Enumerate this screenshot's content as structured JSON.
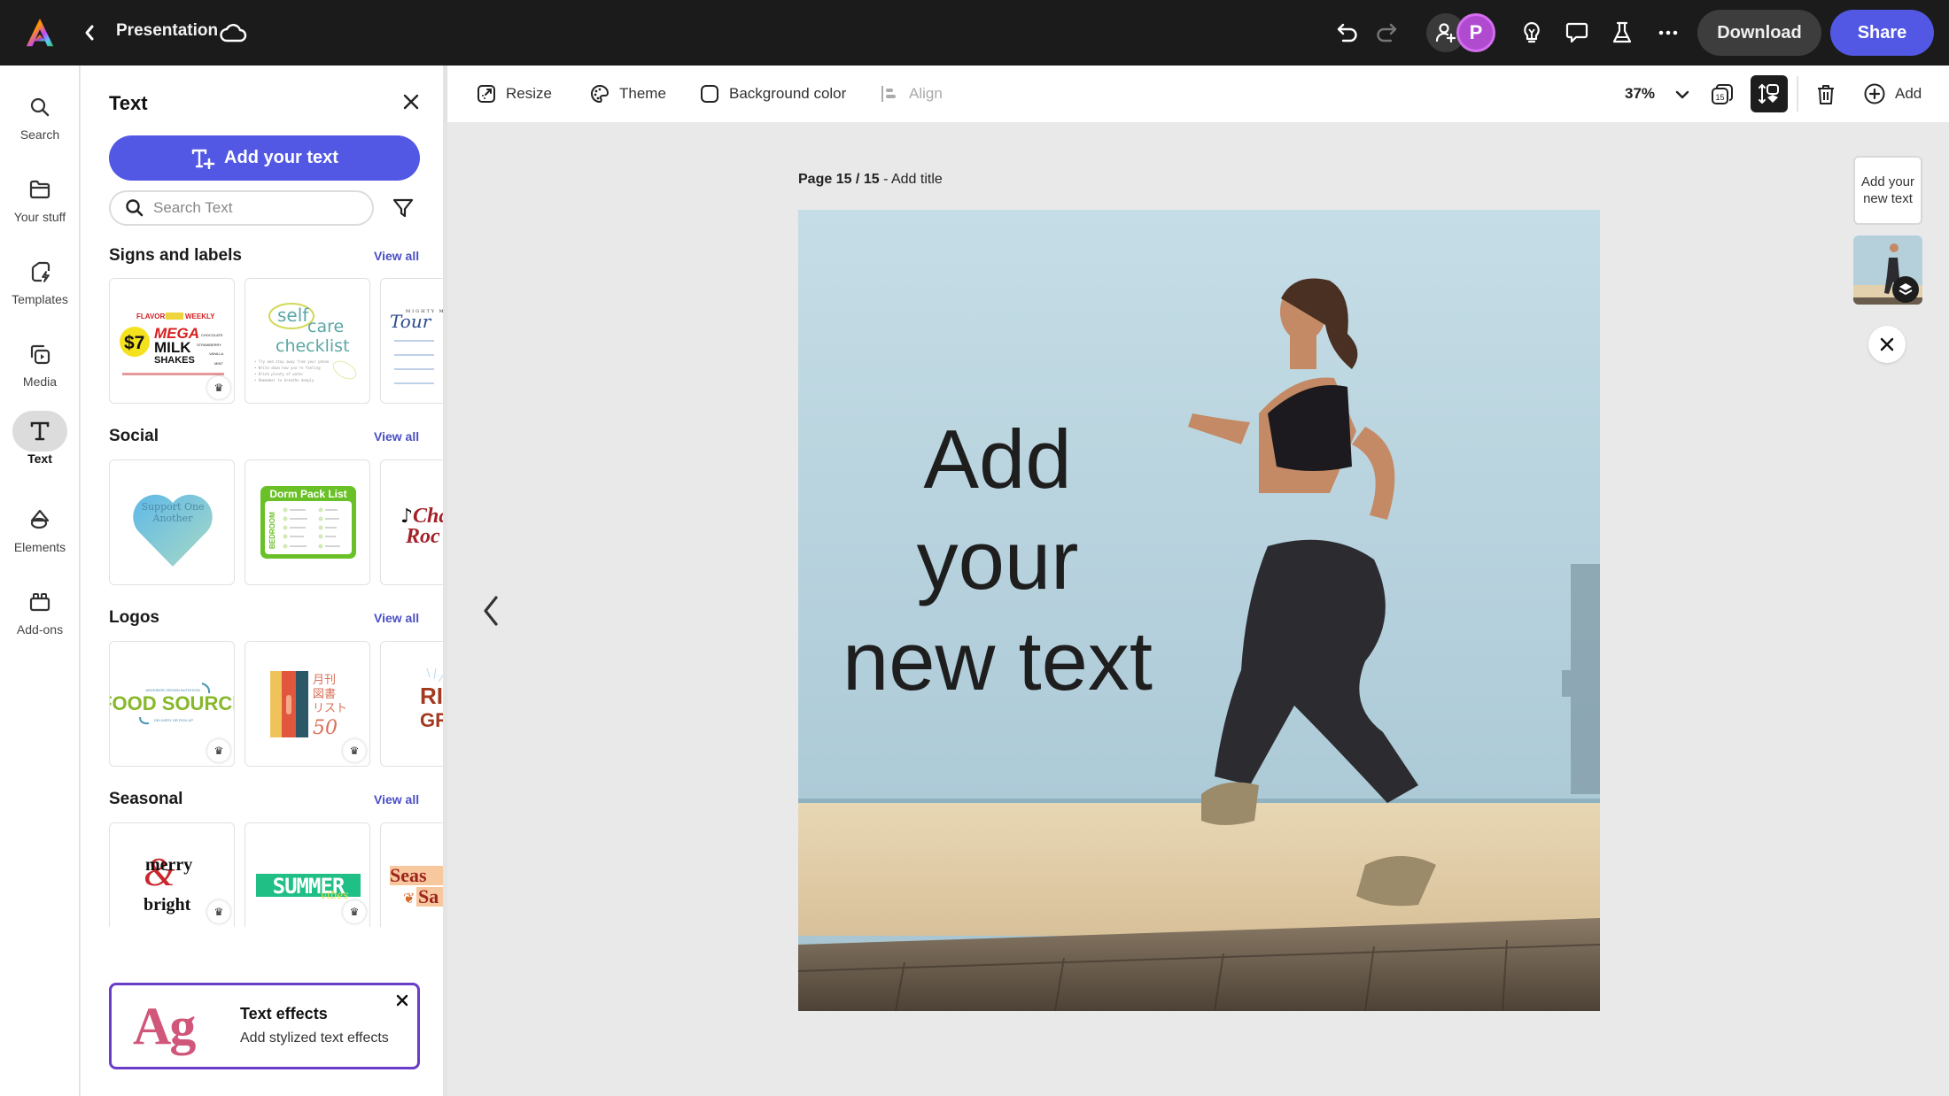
{
  "app": {
    "title": "Presentation",
    "logo_icon": "adobe-express-logo",
    "colors": {
      "accent": "#5258e4",
      "topbar": "#1b1b1b",
      "link": "#4b4fc4",
      "fx_border": "#6a3dc9"
    }
  },
  "topbar": {
    "back_icon": "chevron-left-icon",
    "cloud_icon": "cloud-icon",
    "undo_icon": "undo-icon",
    "redo_icon": "redo-icon",
    "invite_icon": "add-user-icon",
    "avatar_initial": "P",
    "tips_icon": "lightbulb-icon",
    "comments_icon": "comment-icon",
    "labs_icon": "flask-icon",
    "more_icon": "more-icon",
    "download_label": "Download",
    "share_label": "Share"
  },
  "rail": {
    "items": [
      {
        "label": "Search",
        "icon": "search-icon",
        "active": false
      },
      {
        "label": "Your stuff",
        "icon": "folder-icon",
        "active": false
      },
      {
        "label": "Templates",
        "icon": "templates-icon",
        "active": false
      },
      {
        "label": "Media",
        "icon": "media-icon",
        "active": false
      },
      {
        "label": "Text",
        "icon": "text-icon",
        "active": true
      },
      {
        "label": "Elements",
        "icon": "elements-icon",
        "active": false
      },
      {
        "label": "Add-ons",
        "icon": "addons-icon",
        "active": false
      }
    ]
  },
  "panel": {
    "title": "Text",
    "add_text_label": "Add your text",
    "search_placeholder": "Search Text",
    "search_value": "",
    "sections": [
      {
        "title": "Signs and labels",
        "view_all": "View all",
        "cards": [
          {
            "name": "mega-milk-shakes",
            "lines": [
              "FLAVORS CHANGE WEEKLY",
              "$7",
              "MEGA",
              "MILK",
              "SHAKES"
            ],
            "premium": true
          },
          {
            "name": "self-care-checklist",
            "lines": [
              "self",
              "care",
              "checklist"
            ],
            "premium": false
          },
          {
            "name": "tour-dates",
            "lines": [
              "MIGHTY MO",
              "Tour"
            ],
            "premium": false
          }
        ]
      },
      {
        "title": "Social",
        "view_all": "View all",
        "cards": [
          {
            "name": "support-one-another",
            "lines": [
              "Support One",
              "Another"
            ],
            "premium": false
          },
          {
            "name": "dorm-pack-list",
            "lines": [
              "Dorm Pack List",
              "BEDROOM"
            ],
            "premium": false
          },
          {
            "name": "cha-rock",
            "lines": [
              "Cha",
              "Roc"
            ],
            "premium": false
          }
        ]
      },
      {
        "title": "Logos",
        "view_all": "View all",
        "cards": [
          {
            "name": "food-source",
            "lines": [
              "NEIGHBOR GROWN NUTRITION",
              "FOOD SOURCE",
              "DELIVERY OR PICK-UP"
            ],
            "premium": true
          },
          {
            "name": "monthly-books",
            "lines": [
              "月刊",
              "図書",
              "リスト",
              "50"
            ],
            "premium": true
          },
          {
            "name": "rise-and-grind",
            "lines": [
              "RIS",
              "GRIN"
            ],
            "premium": false
          }
        ]
      },
      {
        "title": "Seasonal",
        "view_all": "View all",
        "cards": [
          {
            "name": "merry-bright",
            "lines": [
              "merry",
              "&",
              "bright"
            ],
            "premium": true
          },
          {
            "name": "summer-vibes",
            "lines": [
              "SUMMER",
              "vibes"
            ],
            "premium": true
          },
          {
            "name": "seasonal-sale",
            "lines": [
              "Seas",
              "Sa"
            ],
            "premium": false
          }
        ]
      }
    ],
    "text_effects": {
      "title": "Text effects",
      "subtitle": "Add stylized text effects",
      "preview": "Ag"
    }
  },
  "toolbar": {
    "resize_label": "Resize",
    "theme_label": "Theme",
    "background_label": "Background color",
    "align_label": "Align",
    "zoom": "37%",
    "page_count_badge": "15",
    "add_label": "Add"
  },
  "canvas": {
    "page_label_prefix": "Page 15 / 15",
    "page_label_sep": " - ",
    "page_title_placeholder": "Add title",
    "slide_text_line1": "Add your",
    "slide_text_line2": "new text",
    "image_description": "Woman running on beach boardwalk"
  },
  "side": {
    "thumb_text": "Add your new text"
  }
}
